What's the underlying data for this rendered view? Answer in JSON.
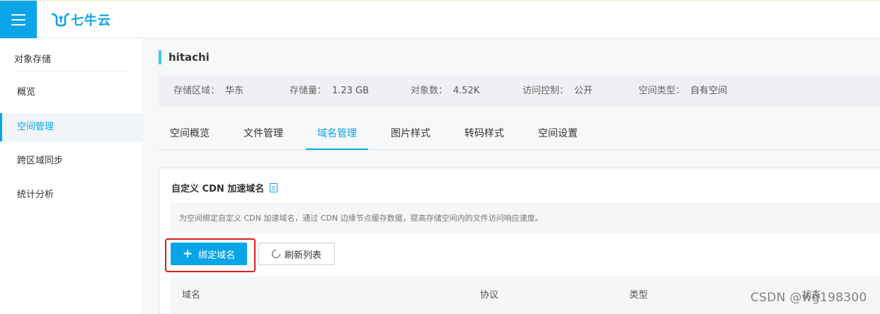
{
  "app": {
    "logo_text": "七牛云"
  },
  "sidebar": {
    "section_title": "对象存储",
    "items": [
      {
        "label": "概览",
        "active": false
      },
      {
        "label": "空间管理",
        "active": true
      },
      {
        "label": "跨区域同步",
        "active": false
      },
      {
        "label": "统计分析",
        "active": false
      }
    ]
  },
  "bucket": {
    "name": "hitachi",
    "stats": [
      {
        "key": "存储区域：",
        "value": "华东"
      },
      {
        "key": "存储量：",
        "value": "1.23 GB"
      },
      {
        "key": "对象数：",
        "value": "4.52K"
      },
      {
        "key": "访问控制：",
        "value": "公开"
      },
      {
        "key": "空间类型：",
        "value": "自有空间"
      }
    ]
  },
  "tabs": [
    {
      "label": "空间概览"
    },
    {
      "label": "文件管理"
    },
    {
      "label": "域名管理",
      "active": true
    },
    {
      "label": "图片样式"
    },
    {
      "label": "转码样式"
    },
    {
      "label": "空间设置"
    }
  ],
  "domain_panel": {
    "title": "自定义 CDN 加速域名",
    "description": "为空间绑定自定义 CDN 加速域名，通过 CDN 边缘节点缓存数据，提高存储空间内的文件访问响应速度。",
    "bind_button": "绑定域名",
    "refresh_button": "刷新列表",
    "columns": [
      "域名",
      "协议",
      "类型",
      "状态"
    ]
  },
  "watermark": "CSDN @wg198300",
  "colors": {
    "accent": "#0aa5e8",
    "highlight": "#e11b1b"
  }
}
